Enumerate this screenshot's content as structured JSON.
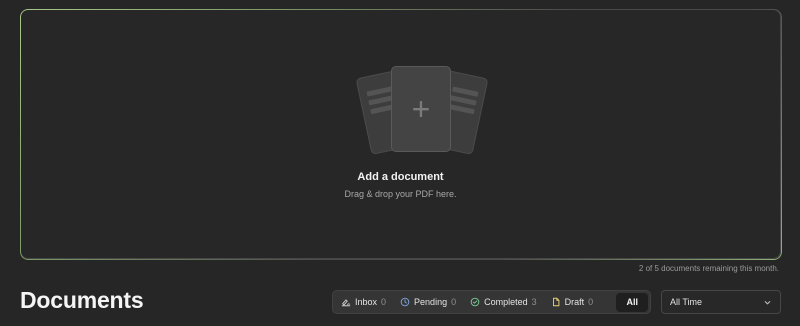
{
  "upload": {
    "title": "Add a document",
    "subtitle": "Drag & drop your PDF here.",
    "plus_icon": "+"
  },
  "quota": {
    "text": "2 of 5 documents remaining this month."
  },
  "page": {
    "title": "Documents"
  },
  "filters": {
    "tabs": [
      {
        "label": "Inbox",
        "count": "0",
        "icon": "inbox-signature-icon",
        "color": "#cfcfcf"
      },
      {
        "label": "Pending",
        "count": "0",
        "icon": "clock-icon",
        "color": "#7fa8e0"
      },
      {
        "label": "Completed",
        "count": "3",
        "icon": "check-circle-icon",
        "color": "#7fcf9a"
      },
      {
        "label": "Draft",
        "count": "0",
        "icon": "file-icon",
        "color": "#e8d27a"
      },
      {
        "label": "All",
        "selected": true
      }
    ]
  },
  "period_select": {
    "value": "All Time",
    "icon": "chevron-down-icon"
  }
}
